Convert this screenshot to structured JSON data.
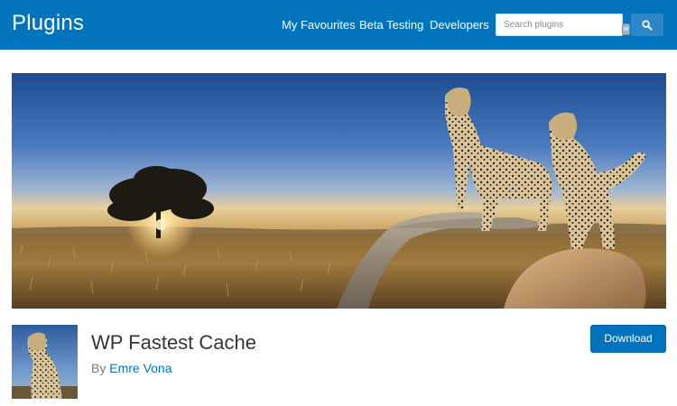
{
  "header": {
    "site_title": "Plugins",
    "nav": {
      "favourites": "My Favourites",
      "beta": "Beta Testing",
      "developers": "Developers"
    },
    "search": {
      "placeholder": "Search plugins",
      "icon": "magnifier-icon"
    },
    "input_badge": "w"
  },
  "plugin": {
    "title": "WP Fastest Cache",
    "by_label": "By",
    "author": "Emre Vona",
    "download_label": "Download",
    "banner_subject": "cheetahs-on-savanna-banner",
    "icon_subject": "cheetah-plugin-icon"
  },
  "colors": {
    "header_bg": "#0274be",
    "link": "#0274be",
    "button_bg": "#0274be",
    "title_text": "#32373c",
    "muted_text": "#777777"
  }
}
